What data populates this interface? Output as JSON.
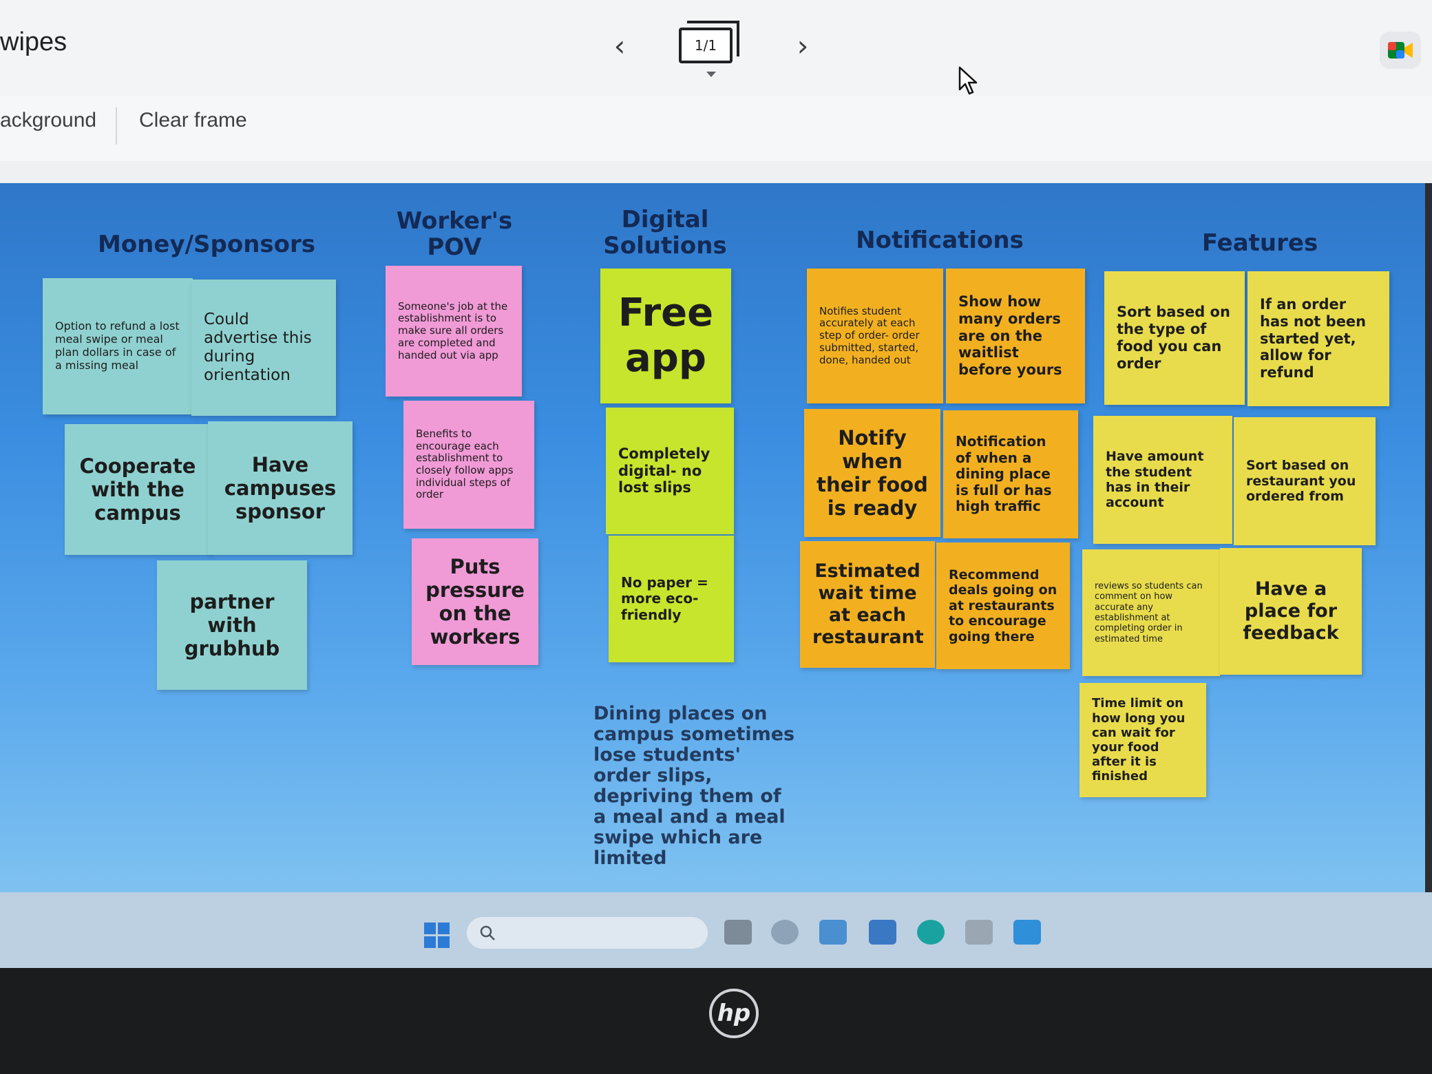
{
  "header": {
    "doc_title": "wipes",
    "frame_counter": "1/1",
    "prev_label": "‹",
    "next_label": "›"
  },
  "toolbar": {
    "background_label": "ackground",
    "clear_frame_label": "Clear frame"
  },
  "board": {
    "headings": {
      "money": "Money/Sponsors",
      "worker": "Worker's POV",
      "digital": "Digital Solutions",
      "notifications": "Notifications",
      "features": "Features"
    },
    "money_notes": [
      "Option to refund a lost meal swipe or meal plan dollars in case of a missing meal",
      "Could advertise this during orientation",
      "Cooperate with the campus",
      "Have campuses sponsor",
      "partner with grubhub"
    ],
    "worker_notes": [
      "Someone's job at the establishment is to make sure all orders are completed and handed out via app",
      "Benefits to encourage each establishment to closely follow apps individual steps of order",
      "Puts pressure on the workers"
    ],
    "digital_notes": [
      "Free app",
      "Completely digital- no lost slips",
      "No paper = more eco-friendly"
    ],
    "notification_notes": [
      "Notifies student accurately at each step of order- order submitted, started, done, handed out",
      "Show how many orders are on the waitlist before yours",
      "Notify when their food is ready",
      "Notification of when a dining place is full or has high traffic",
      "Estimated wait time at each restaurant",
      "Recommend deals going on at restaurants to encourage going there"
    ],
    "feature_notes": [
      "Sort based on the type of food you can order",
      "If an order has not been started yet, allow for refund",
      "Have amount the student has in their account",
      "Sort based on restaurant you ordered from",
      "reviews so students can comment on how accurate any establishment at completing order in estimated time",
      "Have a place for feedback",
      "Time limit on how long you can wait for your food after it is finished"
    ],
    "problem_statement": "Dining places on campus sometimes lose students' order slips, depriving them of a meal and a meal swipe which are limited"
  },
  "colors": {
    "teal": "#8fd1d0",
    "pink": "#f09ad6",
    "lime": "#c7e52c",
    "orange": "#f2b021",
    "yellow": "#e8dc4c",
    "board_blue": "#3a8de0"
  },
  "icons": [
    "prev-arrow-icon",
    "next-arrow-icon",
    "cursor-icon",
    "meet-icon",
    "windows-start-icon",
    "search-icon",
    "hp-logo"
  ]
}
